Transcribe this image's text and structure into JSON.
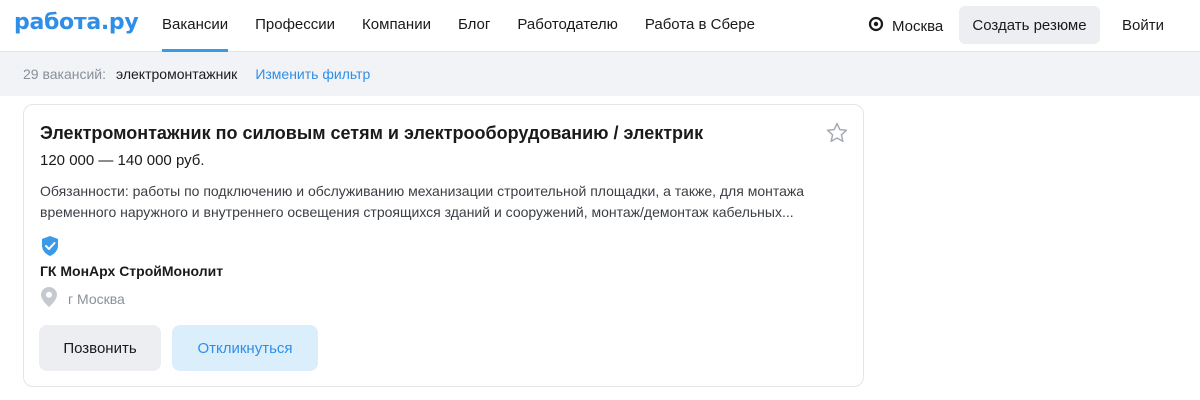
{
  "header": {
    "logo": "работа.ру",
    "nav": [
      {
        "label": "Вакансии",
        "active": true
      },
      {
        "label": "Профессии",
        "active": false
      },
      {
        "label": "Компании",
        "active": false
      },
      {
        "label": "Блог",
        "active": false
      },
      {
        "label": "Работодателю",
        "active": false
      },
      {
        "label": "Работа в Сбере",
        "active": false
      }
    ],
    "city": "Москва",
    "create_resume": "Создать резюме",
    "login": "Войти"
  },
  "filter": {
    "count": "29 вакансий:",
    "query": "электромонтажник",
    "change": "Изменить фильтр"
  },
  "vacancy": {
    "title": "Электромонтажник по силовым сетям и электрооборудованию / электрик",
    "salary": "120 000 — 140 000 руб.",
    "description_line1": "Обязанности: работы по подключению и обслуживанию механизации строительной площадки, а также, для монтажа",
    "description_line2": "временного наружного и внутреннего освещения строящихся зданий и сооружений, монтаж/демонтаж кабельных...",
    "company": "ГК МонАрх СтройМонолит",
    "location": "г Москва",
    "call_button": "Позвонить",
    "respond_button": "Откликнуться"
  },
  "icons": {
    "location_pin": "location-pin-icon",
    "favorite": "star-icon",
    "verified": "verified-shield-icon",
    "address": "map-pin-icon"
  },
  "colors": {
    "accent": "#2f8fe8",
    "respond_bg": "#dbeefc",
    "filter_bg": "#f1f3f6"
  }
}
